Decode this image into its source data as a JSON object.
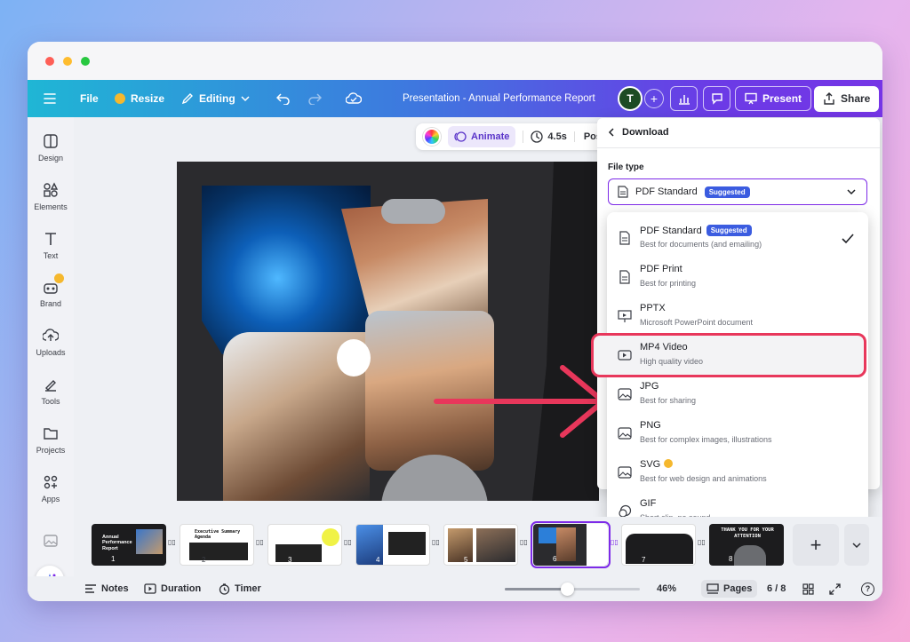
{
  "topbar": {
    "file": "File",
    "resize": "Resize",
    "editing": "Editing",
    "doc_title": "Presentation - Annual Performance Report",
    "avatar_letter": "T",
    "present": "Present",
    "share": "Share"
  },
  "sidebar": {
    "items": [
      {
        "label": "Design"
      },
      {
        "label": "Elements"
      },
      {
        "label": "Text"
      },
      {
        "label": "Brand"
      },
      {
        "label": "Uploads"
      },
      {
        "label": "Tools"
      },
      {
        "label": "Projects"
      },
      {
        "label": "Apps"
      }
    ]
  },
  "context_toolbar": {
    "animate": "Animate",
    "duration": "4.5s",
    "position": "Position"
  },
  "download": {
    "title": "Download",
    "file_type_label": "File type",
    "selected": "PDF Standard",
    "selected_badge": "Suggested",
    "options": [
      {
        "name": "PDF Standard",
        "badge": "Suggested",
        "desc": "Best for documents (and emailing)",
        "checked": true
      },
      {
        "name": "PDF Print",
        "desc": "Best for printing"
      },
      {
        "name": "PPTX",
        "desc": "Microsoft PowerPoint document"
      },
      {
        "name": "MP4 Video",
        "desc": "High quality video",
        "highlighted": true
      },
      {
        "name": "JPG",
        "desc": "Best for sharing"
      },
      {
        "name": "PNG",
        "desc": "Best for complex images, illustrations"
      },
      {
        "name": "SVG",
        "desc": "Best for web design and animations",
        "premium": true
      },
      {
        "name": "GIF",
        "desc": "Short clip, no sound"
      }
    ]
  },
  "pages": {
    "thumbs": [
      {
        "num": "1",
        "text": "Annual Performance Report"
      },
      {
        "num": "2",
        "text": "Executive Summary Agenda"
      },
      {
        "num": "3",
        "text": ""
      },
      {
        "num": "4",
        "text": ""
      },
      {
        "num": "5",
        "text": ""
      },
      {
        "num": "6",
        "text": "",
        "active": true
      },
      {
        "num": "7",
        "text": ""
      },
      {
        "num": "8",
        "text": "THANK YOU FOR YOUR ATTENTION"
      }
    ]
  },
  "footer": {
    "notes": "Notes",
    "duration": "Duration",
    "timer": "Timer",
    "zoom": "46%",
    "zoom_fraction": 0.46,
    "pages": "Pages",
    "page_count": "6 / 8"
  },
  "colors": {
    "accent": "#7d2ae8",
    "highlight_red": "#e8375b",
    "badge_blue": "#3b5ce0"
  }
}
